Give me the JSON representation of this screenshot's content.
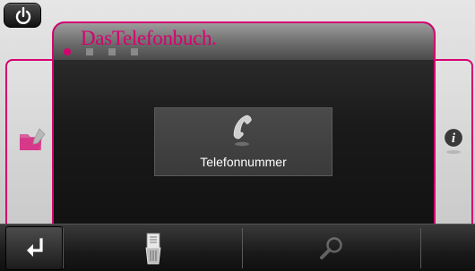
{
  "header": {
    "title": "DasTelefonbuch.",
    "page_dots": 4,
    "active_dot": 0
  },
  "main": {
    "tile_label": "Telefonnummer",
    "tile_icon": "phone-icon"
  },
  "left_panel": {
    "icon": "folder-edit-icon"
  },
  "right_panel": {
    "icon": "info-icon"
  },
  "bottom_bar": {
    "buttons": [
      {
        "icon": "return-arrow-icon"
      },
      {
        "icon": "delete-list-icon"
      },
      {
        "icon": "search-icon"
      }
    ]
  },
  "colors": {
    "accent": "#d6006f",
    "panel_bg": "#1b1b1b",
    "tile_bg": "#444444"
  }
}
